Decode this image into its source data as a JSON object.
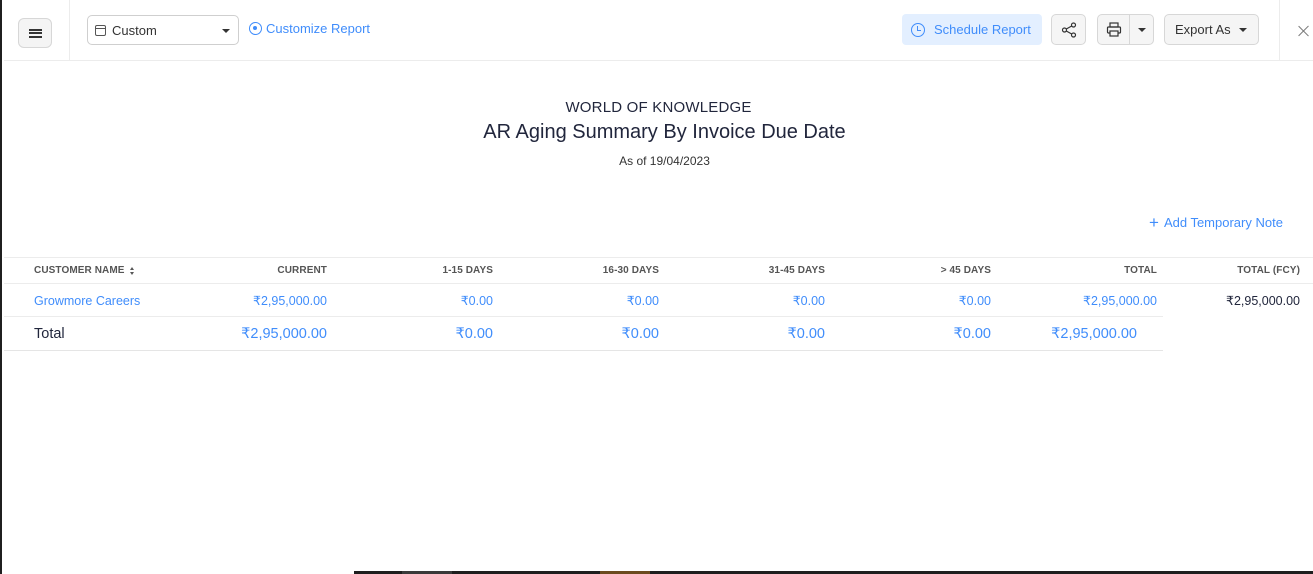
{
  "toolbar": {
    "period_select": "Custom",
    "customize_label": "Customize Report",
    "schedule_label": "Schedule Report",
    "export_label": "Export As"
  },
  "report": {
    "organization": "WORLD OF KNOWLEDGE",
    "title": "AR Aging Summary By Invoice Due Date",
    "as_of": "As of 19/04/2023",
    "add_note_label": "Add Temporary Note"
  },
  "table": {
    "columns": [
      "CUSTOMER NAME",
      "CURRENT",
      "1-15 DAYS",
      "16-30 DAYS",
      "31-45 DAYS",
      "> 45 DAYS",
      "TOTAL",
      "TOTAL (FCY)"
    ],
    "rows": [
      {
        "customer": "Growmore Careers",
        "current": "₹2,95,000.00",
        "d1_15": "₹0.00",
        "d16_30": "₹0.00",
        "d31_45": "₹0.00",
        "d45plus": "₹0.00",
        "total": "₹2,95,000.00",
        "total_fcy": "₹2,95,000.00"
      }
    ],
    "totals": {
      "label": "Total",
      "current": "₹2,95,000.00",
      "d1_15": "₹0.00",
      "d16_30": "₹0.00",
      "d31_45": "₹0.00",
      "d45plus": "₹0.00",
      "total": "₹2,95,000.00"
    }
  },
  "colors": {
    "accent": "#408dfb",
    "schedule_bg": "#e3efff",
    "text": "#21263c"
  },
  "icons": [
    "hamburger-menu-icon",
    "calendar-icon",
    "gear-icon",
    "clock-icon",
    "share-icon",
    "printer-icon",
    "chevron-down-icon",
    "close-icon",
    "plus-icon",
    "sort-icon"
  ]
}
